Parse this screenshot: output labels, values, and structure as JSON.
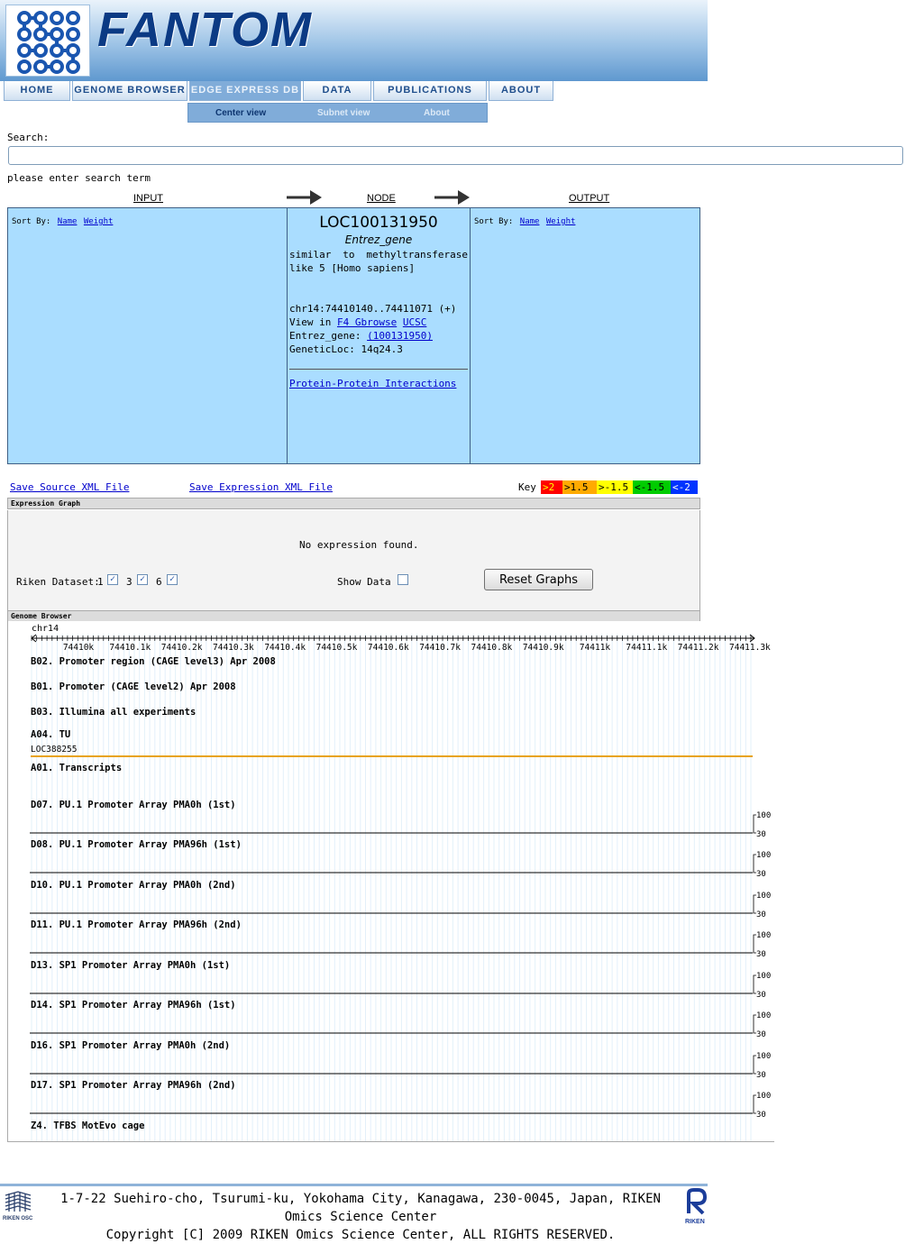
{
  "header": {
    "title": "FANTOM"
  },
  "nav": {
    "tabs": [
      "HOME",
      "GENOME BROWSER",
      "EDGE EXPRESS DB",
      "DATA",
      "PUBLICATIONS",
      "ABOUT"
    ],
    "subtabs": [
      "Center view",
      "Subnet view",
      "About"
    ]
  },
  "search": {
    "label": "Search:",
    "value": "",
    "hint": "please enter search term"
  },
  "columns": {
    "input": "INPUT",
    "node": "NODE",
    "output": "OUTPUT"
  },
  "sort": {
    "label": "Sort By:",
    "name": "Name",
    "weight": "Weight"
  },
  "node": {
    "name": "LOC100131950",
    "type": "Entrez_gene",
    "description": "similar to methyltransferase like 5 [Homo sapiens]",
    "location": "chr14:74410140..74411071 (+)",
    "view_in": "View in",
    "f4": "F4 Gbrowse",
    "ucsc": "UCSC",
    "entrez_label": "Entrez_gene:",
    "entrez_id": "(100131950)",
    "genetic_loc": "GeneticLoc: 14q24.3",
    "ppi": "Protein-Protein Interactions"
  },
  "save": {
    "source": "Save Source XML File",
    "expression": "Save Expression XML File"
  },
  "key": {
    "label": "Key",
    "items": [
      {
        "text": ">2",
        "color": "#ff0000",
        "textcolor": "#ffff00"
      },
      {
        "text": ">1.5",
        "color": "#ffaa00",
        "textcolor": "#000000"
      },
      {
        "text": ">-1.5",
        "color": "#ffff00",
        "textcolor": "#000000"
      },
      {
        "text": "<-1.5",
        "color": "#00cc00",
        "textcolor": "#000000"
      },
      {
        "text": "<-2",
        "color": "#0033ff",
        "textcolor": "#ffffff"
      }
    ]
  },
  "expression": {
    "header": "Expression Graph",
    "empty": "No expression found.",
    "dataset_label": "Riken Dataset:",
    "datasets": [
      "1",
      "3",
      "6"
    ],
    "show_data": "Show Data",
    "reset": "Reset Graphs"
  },
  "genome": {
    "header": "Genome Browser",
    "chrom": "chr14",
    "ticks": [
      "74410k",
      "74410.1k",
      "74410.2k",
      "74410.3k",
      "74410.4k",
      "74410.5k",
      "74410.6k",
      "74410.7k",
      "74410.8k",
      "74410.9k",
      "74411k",
      "74411.1k",
      "74411.2k",
      "74411.3k"
    ],
    "tracks": [
      "B02. Promoter region (CAGE level3) Apr 2008",
      "B01. Promoter (CAGE level2) Apr 2008",
      "B03. Illumina all experiments",
      "A04. TU",
      "A01. Transcripts",
      "D07. PU.1 Promoter Array PMA0h (1st)",
      "D08. PU.1 Promoter Array PMA96h (1st)",
      "D10. PU.1 Promoter Array PMA0h (2nd)",
      "D11. PU.1 Promoter Array PMA96h (2nd)",
      "D13. SP1 Promoter Array PMA0h (1st)",
      "D14. SP1 Promoter Array PMA96h (1st)",
      "D16. SP1 Promoter Array PMA0h (2nd)",
      "D17. SP1 Promoter Array PMA96h (2nd)",
      "Z4. TFBS MotEvo cage"
    ],
    "tu_feature": "LOC388255",
    "scale_max": "100",
    "scale_min": "30",
    "tu_color": "#e8a317"
  },
  "footer": {
    "address": "1-7-22 Suehiro-cho, Tsurumi-ku, Yokohama City, Kanagawa, 230-0045, Japan, RIKEN Omics Science Center",
    "copyright": "Copyright [C] 2009 RIKEN Omics Science Center, ALL RIGHTS RESERVED.",
    "left_logo": "RIKEN OSC",
    "right_logo": "RIKEN"
  }
}
